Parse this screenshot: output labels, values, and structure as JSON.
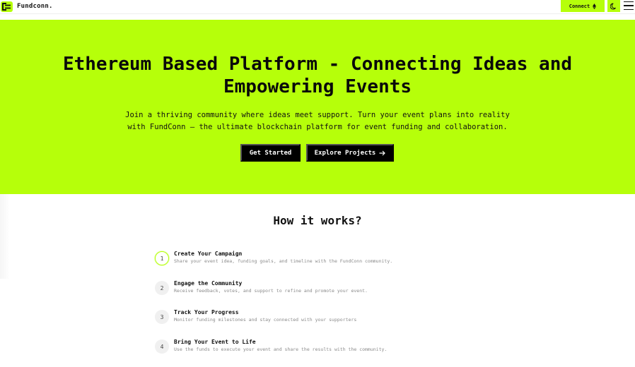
{
  "header": {
    "brand": "Fundconn.",
    "connect_label": "Connect",
    "accent_color": "#b6ff0a"
  },
  "hero": {
    "title": "Ethereum Based Platform - Connecting Ideas and Empowering Events",
    "subtitle": "Join a thriving community where ideas meet support. Turn your event plans into reality with FundConn – the ultimate blockchain platform for event funding and collaboration.",
    "primary_button": "Get Started",
    "secondary_button": "Explore Projects"
  },
  "how_it_works": {
    "title": "How it works?",
    "steps": [
      {
        "number": "1",
        "title": "Create Your Campaign",
        "description": "Share your event idea, funding goals, and timeline with the FundConn community."
      },
      {
        "number": "2",
        "title": "Engage the Community",
        "description": "Receive feedback, votes, and support to refine and promote your event."
      },
      {
        "number": "3",
        "title": "Track Your Progress",
        "description": "Monitor funding milestones and stay connected with your supporters"
      },
      {
        "number": "4",
        "title": "Bring Your Event to Life",
        "description": "Use the funds to execute your event and share the results with the community."
      }
    ]
  }
}
